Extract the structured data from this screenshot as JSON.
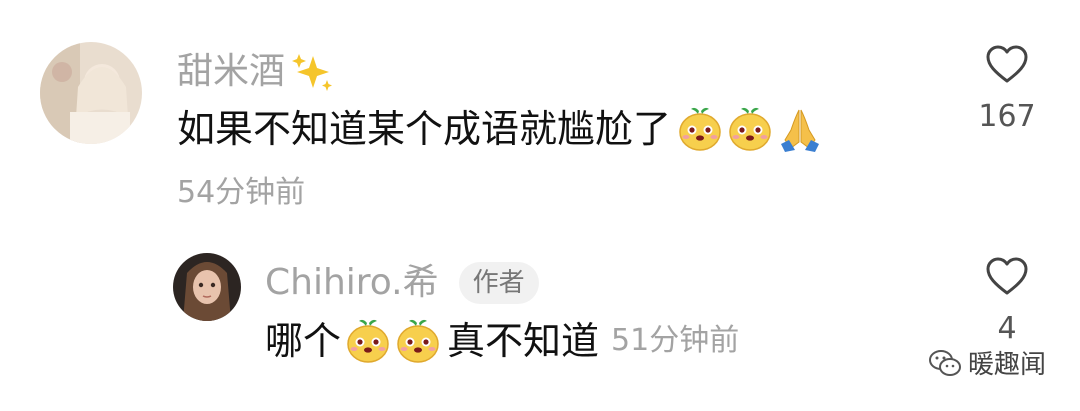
{
  "comments": [
    {
      "username": "甜米酒",
      "username_decoration_icon": "sparkles-icon",
      "text": "如果不知道某个成语就尴尬了",
      "emojis": [
        "bear-face-emoji",
        "bear-face-emoji",
        "praying-hands-emoji"
      ],
      "time": "54分钟前",
      "like_icon": "heart-outline-icon",
      "like_count": "167"
    },
    {
      "username": "Chihiro.希",
      "author_badge": "作者",
      "text_before": "哪个",
      "emojis": [
        "bear-face-emoji",
        "bear-face-emoji"
      ],
      "text_after": "真不知道",
      "time": "51分钟前",
      "like_icon": "heart-outline-icon",
      "like_count": "4"
    }
  ],
  "watermark": {
    "label": "暖趣闻",
    "icon": "wechat-logo-icon"
  },
  "colors": {
    "muted": "#a3a3a3",
    "text": "#111111",
    "badge_bg": "#f1f1f1"
  }
}
